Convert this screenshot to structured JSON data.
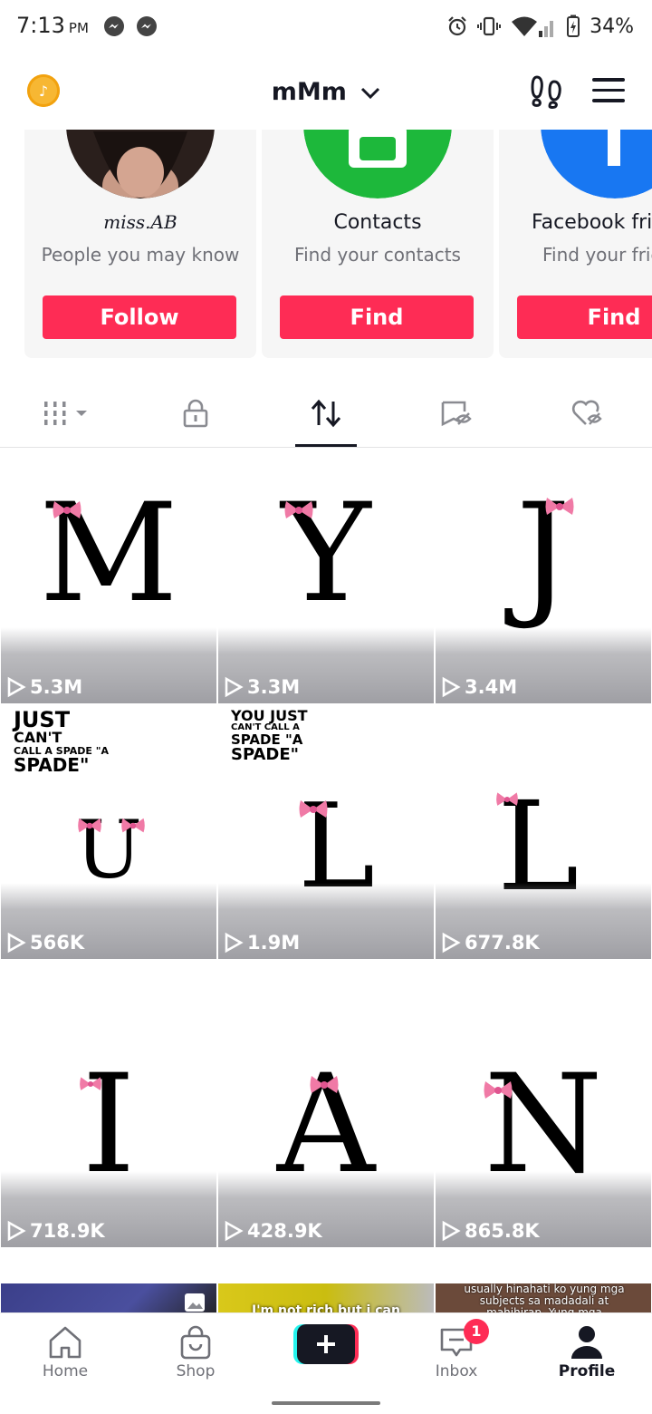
{
  "status_bar": {
    "time": "7:13",
    "ampm": "PM",
    "battery": "34%"
  },
  "header": {
    "username": "mMm"
  },
  "suggestions": [
    {
      "name": "miss.AB",
      "subtitle": "People you may know",
      "button": "Follow"
    },
    {
      "name": "Contacts",
      "subtitle": "Find your contacts",
      "button": "Find"
    },
    {
      "name": "Facebook friends",
      "subtitle": "Find your friends",
      "button": "Find"
    }
  ],
  "tabs": [
    "videos-grid",
    "private",
    "reposts",
    "favorites",
    "liked"
  ],
  "videos": [
    {
      "letter": "M",
      "views": "5.3M"
    },
    {
      "letter": "Y",
      "views": "3.3M"
    },
    {
      "letter": "J",
      "views": "3.4M"
    },
    {
      "letter": "U",
      "views": "566K",
      "caption": [
        "JUST",
        "CAN'T",
        "CALL A SPADE \"A",
        "SPADE\""
      ]
    },
    {
      "letter": "L",
      "views": "1.9M",
      "caption": [
        "YOU JUST",
        "CAN'T CALL A",
        "SPADE \"A",
        "SPADE\""
      ]
    },
    {
      "letter": "L",
      "views": "677.8K"
    },
    {
      "letter": "I",
      "views": "718.9K"
    },
    {
      "letter": "A",
      "views": "428.9K"
    },
    {
      "letter": "N",
      "views": "865.8K"
    }
  ],
  "partial_tiles": [
    {
      "text": ""
    },
    {
      "text": "I'm not rich but i can"
    },
    {
      "text": "usually hinahati ko yung mga subjects sa madadali at mahihirap. Yung mga"
    }
  ],
  "bottom_nav": {
    "home": "Home",
    "shop": "Shop",
    "inbox": "Inbox",
    "inbox_badge": "1",
    "profile": "Profile"
  },
  "colors": {
    "accent": "#fe2c55",
    "contacts_green": "#1db83b",
    "facebook_blue": "#1877f2"
  }
}
